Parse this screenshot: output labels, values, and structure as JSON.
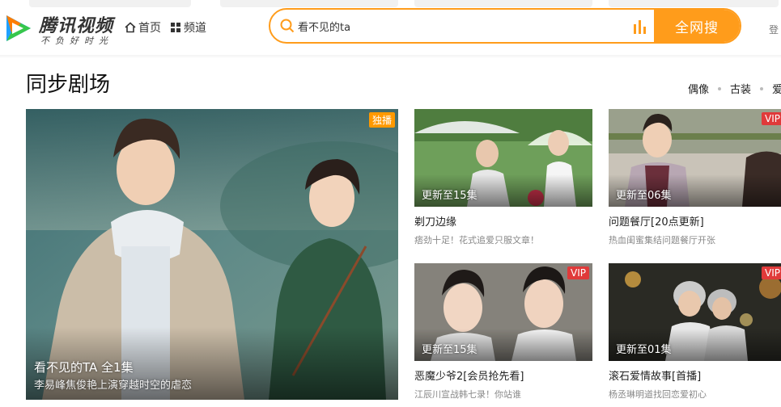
{
  "header": {
    "logo_title": "腾讯视频",
    "logo_slogan": "不负好时光",
    "nav_home": "首页",
    "nav_channel": "频道",
    "search_value": "看不见的ta",
    "search_button": "全网搜",
    "right_partial": "登"
  },
  "section": {
    "title": "同步剧场",
    "tags": [
      "偶像",
      "古装",
      "爱"
    ]
  },
  "featured": {
    "badge": "独播",
    "title": "看不见的TA 全1集",
    "subtitle": "李易峰焦俊艳上演穿越时空的虐恋"
  },
  "cards": [
    {
      "episode": "更新至15集",
      "title": "剃刀边缘",
      "desc": "痞劲十足！花式追爱只服文章！",
      "badge": ""
    },
    {
      "episode": "更新至06集",
      "title": "问题餐厅[20点更新]",
      "desc": "热血闺蜜集结问题餐厅开张",
      "badge": "VIP"
    },
    {
      "episode": "更新至15集",
      "title": "恶魔少爷2[会员抢先看]",
      "desc": "江辰川宣战韩七录！你站谁",
      "badge": "VIP"
    },
    {
      "episode": "更新至01集",
      "title": "滚石爱情故事[首播]",
      "desc": "杨丞琳明道找回恋爱初心",
      "badge": "VIP"
    }
  ],
  "colors": {
    "accent": "#ff9c1b",
    "vip_badge": "#e03a3a",
    "exclusive_badge": "#ff9900"
  },
  "icons": [
    "home-icon",
    "grid-icon",
    "search-icon",
    "hot-bars-icon",
    "tencent-video-logo"
  ]
}
